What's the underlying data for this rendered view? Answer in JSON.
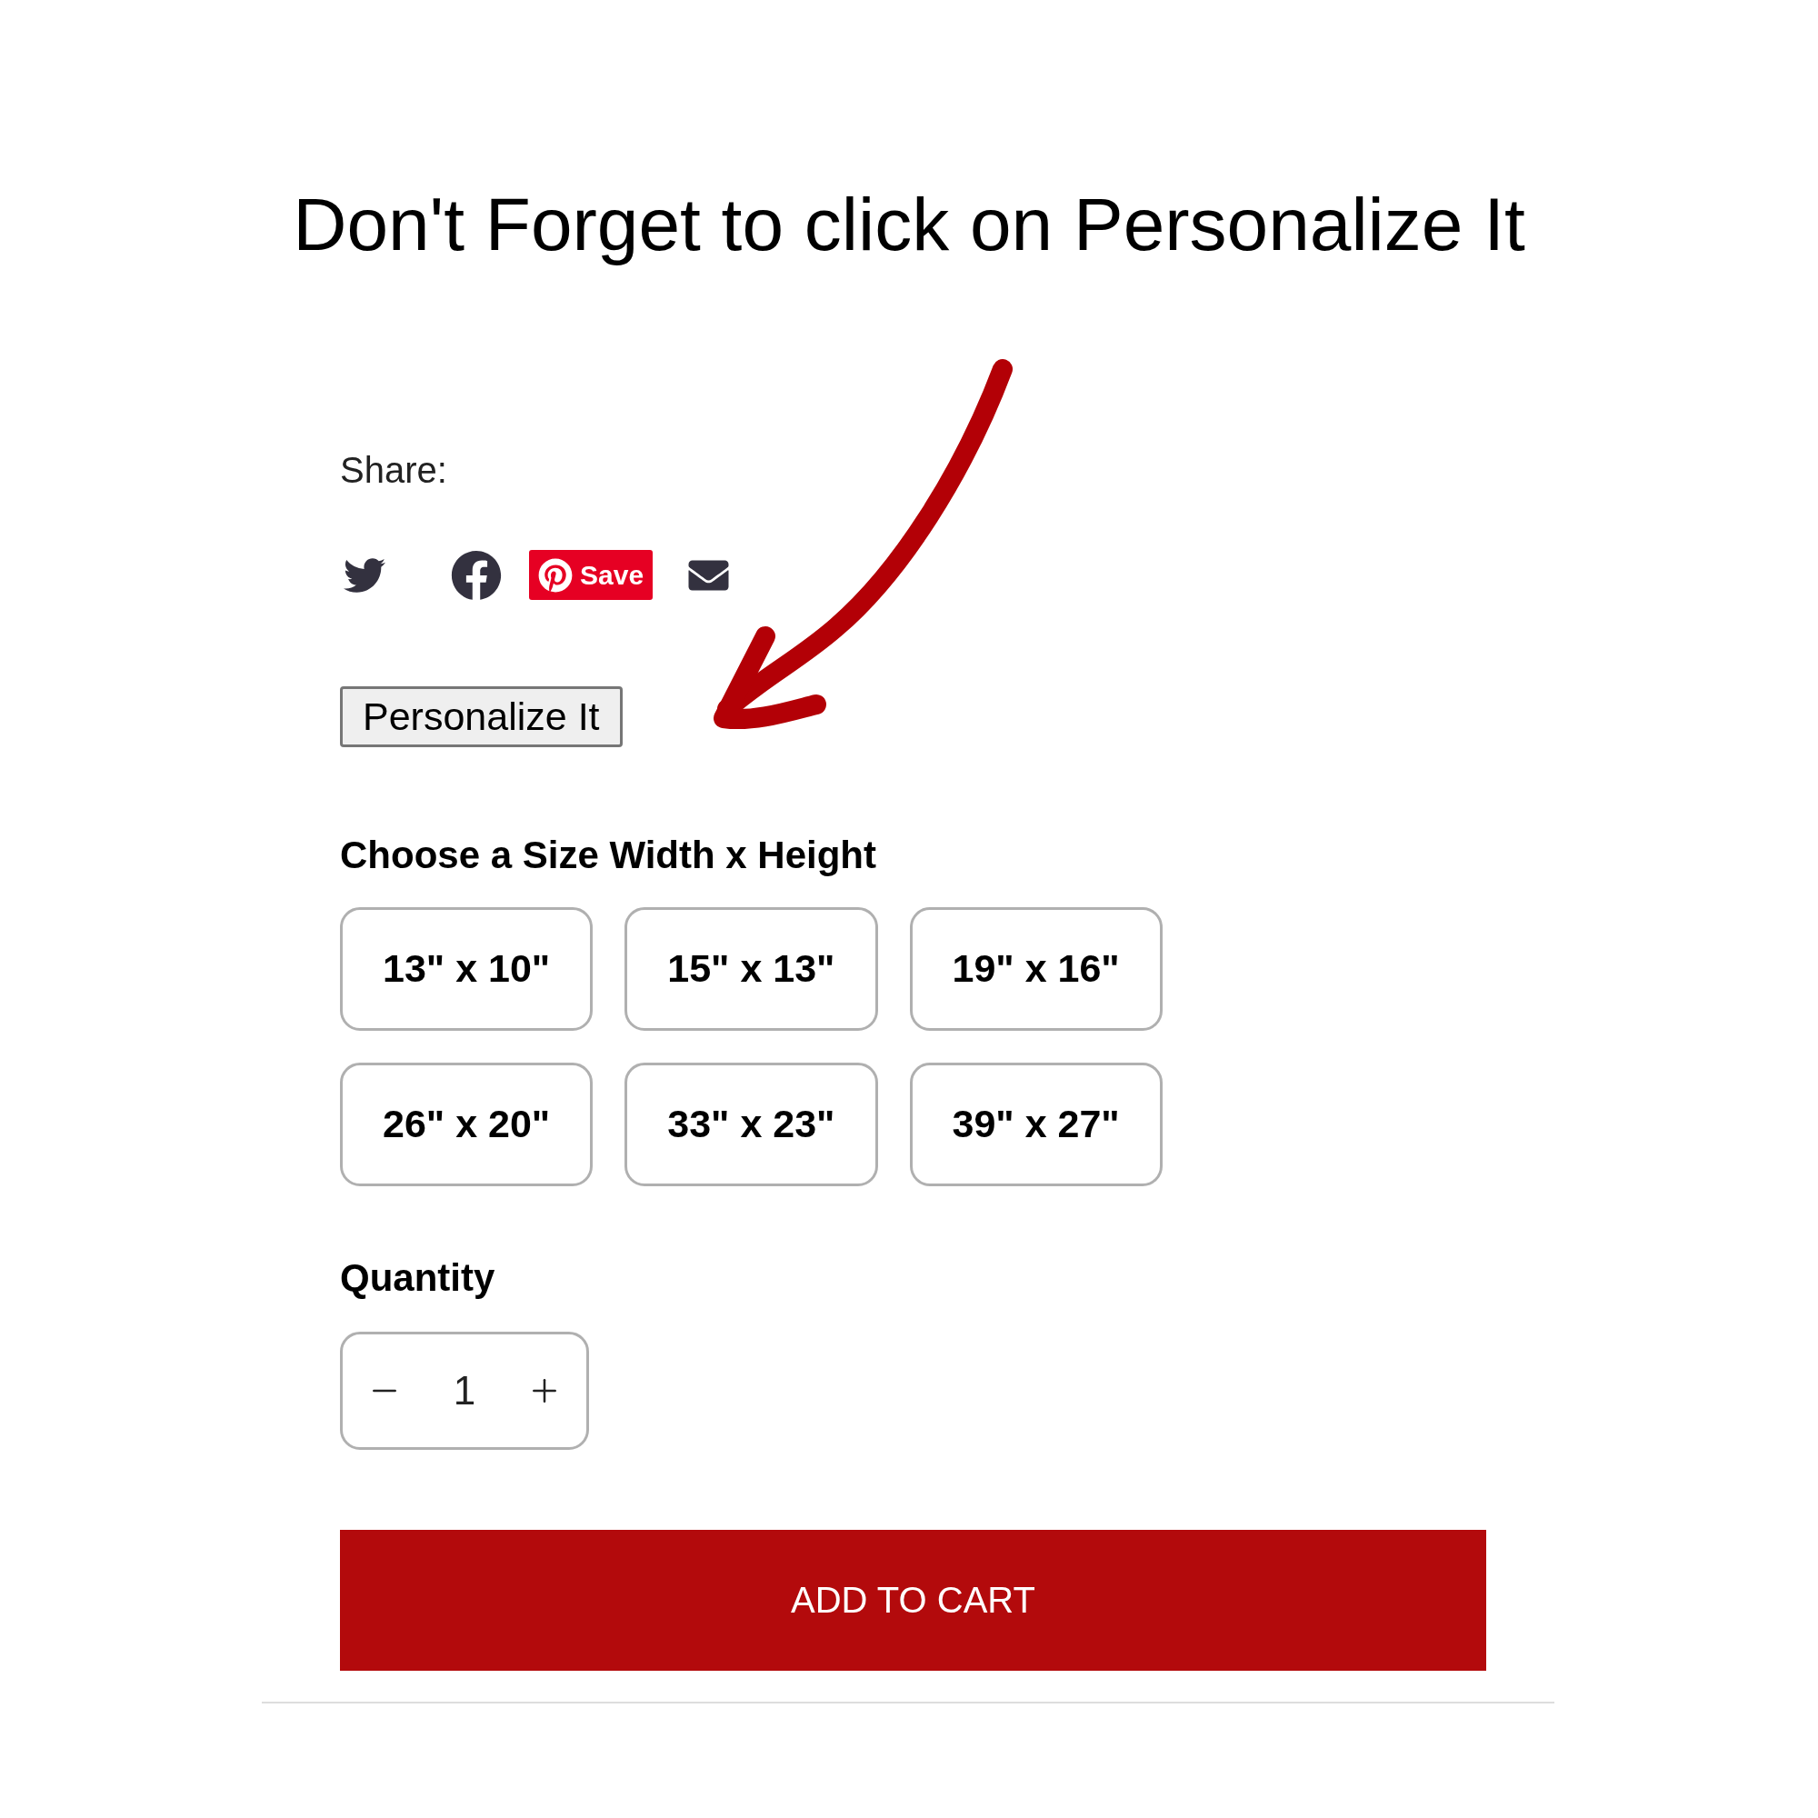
{
  "heading": "Don't Forget to click on Personalize It",
  "share": {
    "label": "Share:",
    "save_button": "Save"
  },
  "personalize_button": "Personalize It",
  "size": {
    "label": "Choose a Size Width x Height",
    "options": [
      {
        "label": "13\" x 10\""
      },
      {
        "label": "15\" x 13\""
      },
      {
        "label": "19\" x 16\""
      },
      {
        "label": "26\" x 20\""
      },
      {
        "label": "33\" x 23\""
      },
      {
        "label": "39\" x 27\""
      }
    ]
  },
  "quantity": {
    "label": "Quantity",
    "value": "1"
  },
  "add_to_cart": "ADD TO CART"
}
